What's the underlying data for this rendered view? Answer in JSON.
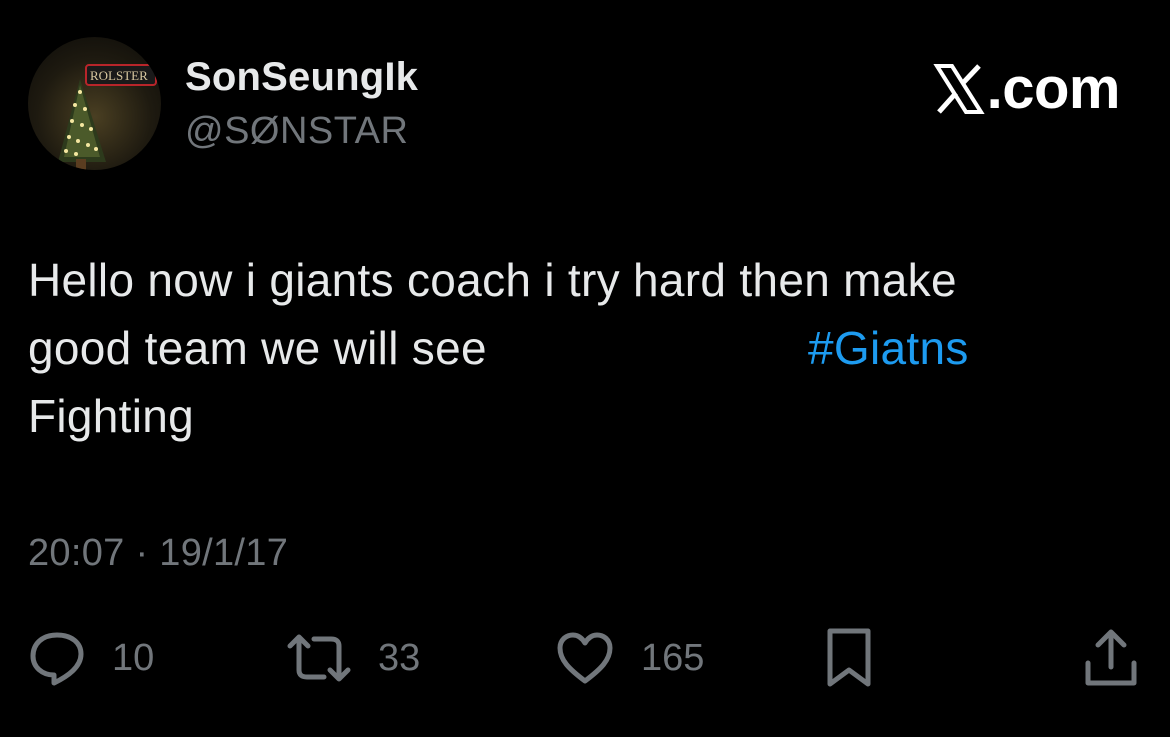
{
  "author": {
    "display_name": "SonSeungIk",
    "handle": "@SØNSTAR",
    "avatar_icon": "avatar-christmas-tree"
  },
  "brand": {
    "label": ".com",
    "icon": "x-logo-icon"
  },
  "tweet": {
    "line1": "Hello now i giants coach i try hard then make",
    "line2": "good team we will see",
    "hashtag": "#Giatns",
    "line3": "Fighting",
    "timestamp": "20:07 · 19/1/17"
  },
  "actions": {
    "replies": "10",
    "retweets": "33",
    "likes": "165"
  },
  "colors": {
    "background": "#000000",
    "text": "#e7e9ea",
    "secondary": "#71767b",
    "link": "#1d9bf0"
  }
}
